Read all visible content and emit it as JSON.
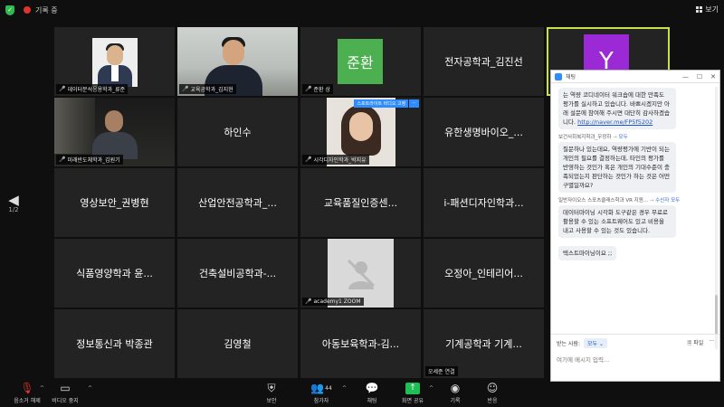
{
  "topbar": {
    "recording_label": "기록 중",
    "view_label": "보기"
  },
  "page_nav": {
    "indicator": "1/2"
  },
  "tiles": [
    {
      "label": "데이터분석응용학과_류준"
    },
    {
      "label": "교육공학과_김지현",
      "extra": ""
    },
    {
      "avatar_text": "준환",
      "label": "준환 상"
    },
    {
      "name": "전자공학과_김진선"
    },
    {
      "avatar_letter": "Y"
    },
    {
      "label": "미래반도체학과_김원기"
    },
    {
      "name": "하인수"
    },
    {
      "label": "시각디자인학과_박지유",
      "active_tag": "스포트라이트 비디오 고정"
    },
    {
      "name": "유한생명바이오_..."
    },
    {
      "name": "영상보안_권병현"
    },
    {
      "name": "산업안전공학과_..."
    },
    {
      "name": "교육품질인증센..."
    },
    {
      "name": "i-패션디자인학과..."
    },
    {
      "name": "식품영양학과 윤..."
    },
    {
      "name": "건축설비공학과-..."
    },
    {
      "label": "academy1 ZOOM"
    },
    {
      "name": "오정아_인테리어..."
    },
    {
      "name": "정보통신과 박종관"
    },
    {
      "name": "김영철"
    },
    {
      "name": "아동보육학과-김..."
    },
    {
      "name": "기계공학과 기계...",
      "label": "오세준 연결"
    }
  ],
  "toolbar": {
    "mute_label": "음소거 해제",
    "video_label": "비디오 중지",
    "security_label": "보안",
    "participants_label": "참가자",
    "participants_count": "44",
    "chat_label": "채팅",
    "share_label": "화면 공유",
    "record_label": "기록",
    "reactions_label": "반응"
  },
  "chat": {
    "title": "채팅",
    "msg1": "는 역량 코디네이터 워크숍에 대한 만족도 평가를 실시하고 있습니다. 바쁘시겠지만 아래 설문에 참여해 주시면 대단히 감사하겠습니다.",
    "msg1_link": "http://naver.me/FP5f5202",
    "sender2": "보건사회복지학과_우정하",
    "sender2_to": "모두",
    "msg2": "질문하나 있는데요, 역량평가에 기반이 되는 개인의 필요를 결정하는데, 타인의 평가를 반영하는 것인가 혹은 개인의 기대수준이 충족되었는지 판단하는 것인가 하는 것은 어떤 구별일까요?",
    "sender3": "일반자이오스 스포츠클래스학과 VR 지원...",
    "sender3_to": "수신자 모두",
    "msg3": "데이터마이닝 시각화 도구같은 경우 무료로 활용할 수 있는 소프트웨어도 있고 비용을 내고 사용할 수 있는 것도 있습니다.",
    "msg4": "텍스트마이닝이요 ;;",
    "to_label": "받는 사람:",
    "to_value": "모두",
    "file_label": "파일",
    "input_placeholder": "여기에 메시지 입력..."
  }
}
